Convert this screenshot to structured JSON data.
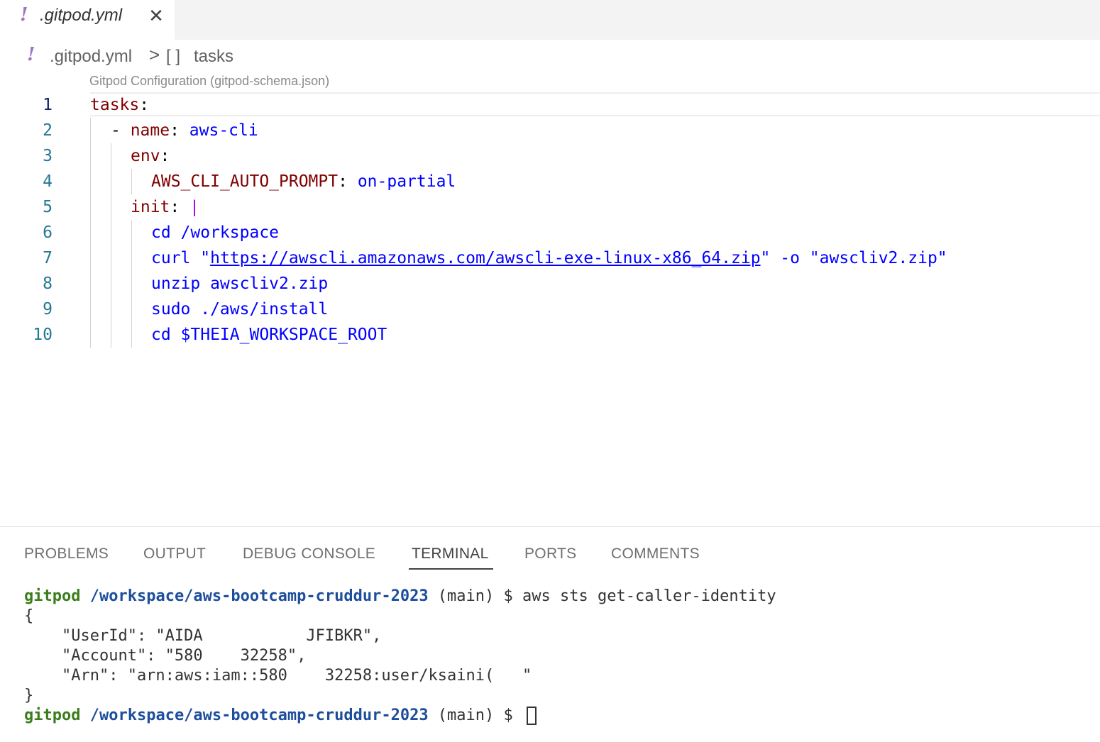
{
  "tab": {
    "icon": "yaml-exclamation-icon",
    "filename": ".gitpod.yml",
    "close_glyph": "✕"
  },
  "breadcrumb": {
    "file": ".gitpod.yml",
    "separator": ">",
    "symbol_icon": "[ ]",
    "symbol": "tasks"
  },
  "schema_hint": "Gitpod Configuration (gitpod-schema.json)",
  "editor": {
    "line_numbers": [
      "1",
      "2",
      "3",
      "4",
      "5",
      "6",
      "7",
      "8",
      "9",
      "10"
    ],
    "lines": {
      "l1_key": "tasks",
      "l1_colon": ":",
      "l2_dash": "- ",
      "l2_key": "name",
      "l2_colon": ": ",
      "l2_val": "aws-cli",
      "l3_key": "env",
      "l3_colon": ":",
      "l4_key": "AWS_CLI_AUTO_PROMPT",
      "l4_colon": ": ",
      "l4_val": "on-partial",
      "l5_key": "init",
      "l5_colon": ": ",
      "l5_pipe": "|",
      "l6": "cd /workspace",
      "l7_a": "curl \"",
      "l7_url": "https://awscli.amazonaws.com/awscli-exe-linux-x86_64.zip",
      "l7_b": "\" -o \"awscliv2.zip\"",
      "l8": "unzip awscliv2.zip",
      "l9": "sudo ./aws/install",
      "l10": "cd $THEIA_WORKSPACE_ROOT"
    }
  },
  "panel": {
    "tabs": [
      "PROBLEMS",
      "OUTPUT",
      "DEBUG CONSOLE",
      "TERMINAL",
      "PORTS",
      "COMMENTS"
    ],
    "active_tab": "TERMINAL"
  },
  "terminal": {
    "prompt_user": "gitpod",
    "prompt_path": "/workspace/aws-bootcamp-cruddur-2023",
    "prompt_branch": " (main) $ ",
    "command": "aws sts get-caller-identity",
    "output": [
      "{",
      "    \"UserId\": \"AIDA           JFIBKR\",",
      "    \"Account\": \"580    32258\",",
      "    \"Arn\": \"arn:aws:iam::580    32258:user/ksaini(   \"",
      "}"
    ]
  },
  "colors": {
    "yaml_key": "#800000",
    "yaml_value": "#0000ff",
    "line_number": "#237893",
    "terminal_user": "#3a7d1b",
    "terminal_path": "#1d4e9b",
    "yaml_icon": "#a074c4"
  }
}
